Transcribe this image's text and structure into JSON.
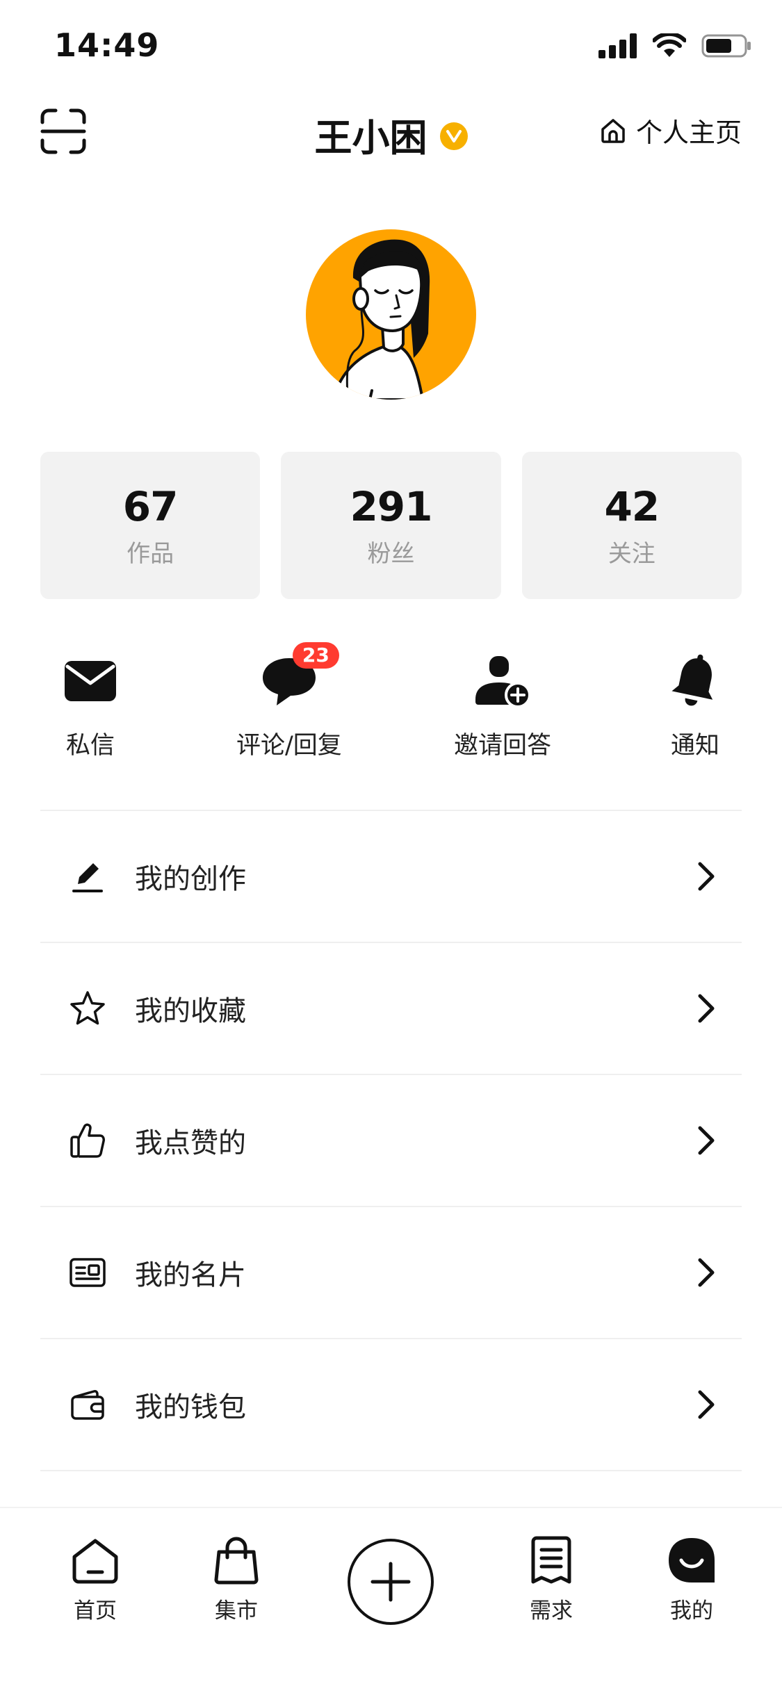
{
  "status_bar": {
    "time": "14:49"
  },
  "header": {
    "title": "王小困",
    "verified_badge": "V",
    "home_link_label": "个人主页"
  },
  "stats": [
    {
      "value": "67",
      "label": "作品"
    },
    {
      "value": "291",
      "label": "粉丝"
    },
    {
      "value": "42",
      "label": "关注"
    }
  ],
  "actions": [
    {
      "label": "私信",
      "icon": "mail-icon"
    },
    {
      "label": "评论/回复",
      "icon": "chat-bubble-icon",
      "badge": "23"
    },
    {
      "label": "邀请回答",
      "icon": "add-user-icon"
    },
    {
      "label": "通知",
      "icon": "bell-icon"
    }
  ],
  "menu": [
    {
      "label": "我的创作",
      "icon": "pen-icon"
    },
    {
      "label": "我的收藏",
      "icon": "star-icon"
    },
    {
      "label": "我点赞的",
      "icon": "thumbs-up-icon"
    },
    {
      "label": "我的名片",
      "icon": "id-card-icon"
    },
    {
      "label": "我的钱包",
      "icon": "wallet-icon"
    }
  ],
  "tabbar": {
    "tabs": [
      {
        "label": "首页",
        "icon": "home-icon"
      },
      {
        "label": "集市",
        "icon": "shopping-bag-icon"
      },
      {
        "label": "需求",
        "icon": "document-icon"
      },
      {
        "label": "我的",
        "icon": "smile-icon",
        "active": true
      }
    ],
    "create_icon": "plus-icon"
  },
  "colors": {
    "accent": "#ffa300",
    "badge": "#ff3b30",
    "verified": "#f7b000"
  }
}
